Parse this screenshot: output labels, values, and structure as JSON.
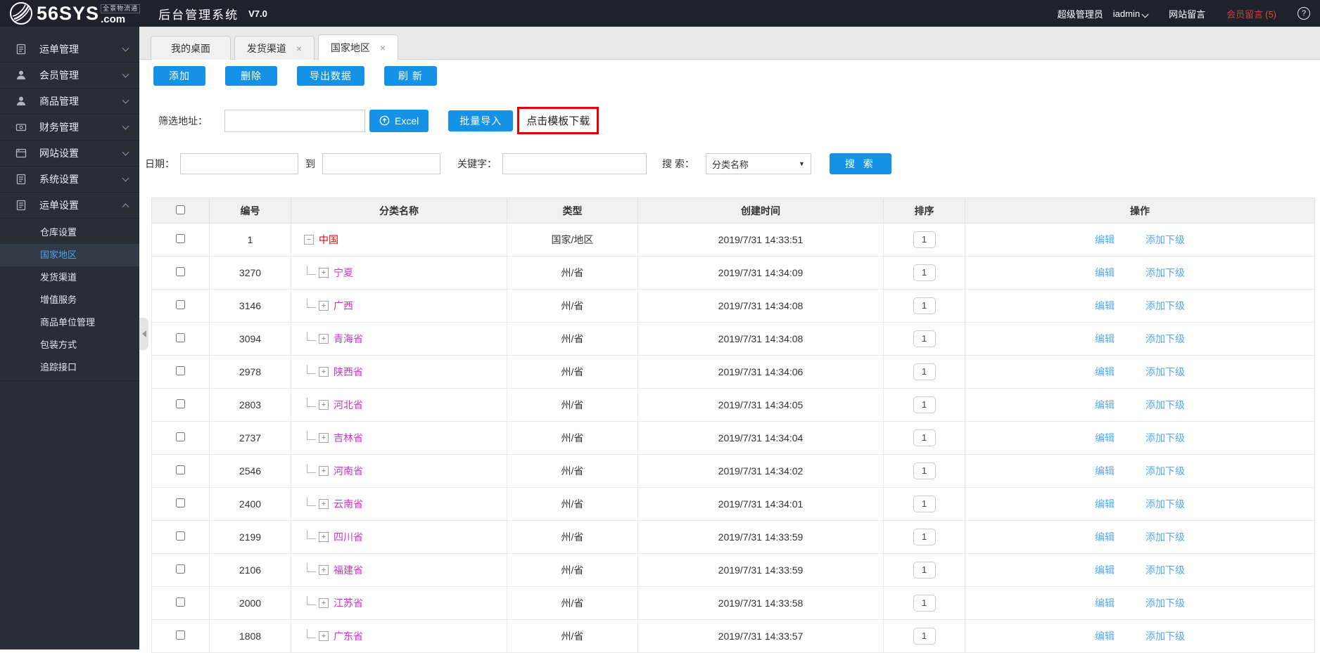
{
  "topbar": {
    "logo_main": "56SYS",
    "logo_suffix": ".com",
    "logo_tagline": "全景物流通",
    "app_title": "后台管理系统",
    "version": "V7.0",
    "role": "超级管理员",
    "username": "iadmin",
    "site_messages": "网站留言",
    "member_messages": "会员留言",
    "member_messages_count": "(5)",
    "help": "?"
  },
  "sidebar": {
    "items": [
      {
        "key": "waybill-manage",
        "label": "运单管理",
        "icon": "document-icon"
      },
      {
        "key": "member-manage",
        "label": "会员管理",
        "icon": "person-icon"
      },
      {
        "key": "goods-manage",
        "label": "商品管理",
        "icon": "person-icon"
      },
      {
        "key": "finance-manage",
        "label": "财务管理",
        "icon": "money-icon"
      },
      {
        "key": "site-settings",
        "label": "网站设置",
        "icon": "browser-icon"
      },
      {
        "key": "system-settings",
        "label": "系统设置",
        "icon": "document-icon"
      },
      {
        "key": "waybill-settings",
        "label": "运单设置",
        "icon": "document-icon",
        "expanded": true,
        "children": [
          {
            "key": "warehouse-settings",
            "label": "仓库设置"
          },
          {
            "key": "country-region",
            "label": "国家地区",
            "active": true
          },
          {
            "key": "shipping-channel",
            "label": "发货渠道"
          },
          {
            "key": "value-added",
            "label": "增值服务"
          },
          {
            "key": "goods-unit",
            "label": "商品单位管理"
          },
          {
            "key": "packing-method",
            "label": "包装方式"
          },
          {
            "key": "tracking-api",
            "label": "追踪接口"
          }
        ]
      }
    ]
  },
  "tabs": [
    {
      "key": "my-desktop",
      "label": "我的桌面",
      "closable": false,
      "active": false
    },
    {
      "key": "shipping-channel",
      "label": "发货渠道",
      "closable": true,
      "active": false
    },
    {
      "key": "country-region",
      "label": "国家地区",
      "closable": true,
      "active": true
    }
  ],
  "toolbar": {
    "add": "添加",
    "delete": "删除",
    "export": "导出数据",
    "refresh": "刷 新"
  },
  "filters": {
    "address_label": "筛选地址：",
    "address_value": "",
    "excel_button": "Excel",
    "batch_import": "批量导入",
    "template_download": "点击模板下载",
    "date_label": "日期：",
    "date_from": "",
    "to_label": "到",
    "date_to": "",
    "keyword_label": "关键字：",
    "keyword_value": "",
    "search_label": "搜 索：",
    "search_type_selected": "分类名称",
    "search_button": "搜 索"
  },
  "table": {
    "headers": [
      "编号",
      "分类名称",
      "类型",
      "创建时间",
      "排序",
      "操作"
    ],
    "edit_label": "编辑",
    "add_child_label": "添加下级",
    "rows": [
      {
        "id": "1",
        "name": "中国",
        "level": 0,
        "toggle": "−",
        "type": "国家/地区",
        "created": "2019/7/31 14:33:51",
        "sort": "1"
      },
      {
        "id": "3270",
        "name": "宁夏",
        "level": 1,
        "toggle": "+",
        "type": "州/省",
        "created": "2019/7/31 14:34:09",
        "sort": "1"
      },
      {
        "id": "3146",
        "name": "广西",
        "level": 1,
        "toggle": "+",
        "type": "州/省",
        "created": "2019/7/31 14:34:08",
        "sort": "1"
      },
      {
        "id": "3094",
        "name": "青海省",
        "level": 1,
        "toggle": "+",
        "type": "州/省",
        "created": "2019/7/31 14:34:08",
        "sort": "1"
      },
      {
        "id": "2978",
        "name": "陕西省",
        "level": 1,
        "toggle": "+",
        "type": "州/省",
        "created": "2019/7/31 14:34:06",
        "sort": "1"
      },
      {
        "id": "2803",
        "name": "河北省",
        "level": 1,
        "toggle": "+",
        "type": "州/省",
        "created": "2019/7/31 14:34:05",
        "sort": "1"
      },
      {
        "id": "2737",
        "name": "吉林省",
        "level": 1,
        "toggle": "+",
        "type": "州/省",
        "created": "2019/7/31 14:34:04",
        "sort": "1"
      },
      {
        "id": "2546",
        "name": "河南省",
        "level": 1,
        "toggle": "+",
        "type": "州/省",
        "created": "2019/7/31 14:34:02",
        "sort": "1"
      },
      {
        "id": "2400",
        "name": "云南省",
        "level": 1,
        "toggle": "+",
        "type": "州/省",
        "created": "2019/7/31 14:34:01",
        "sort": "1"
      },
      {
        "id": "2199",
        "name": "四川省",
        "level": 1,
        "toggle": "+",
        "type": "州/省",
        "created": "2019/7/31 14:33:59",
        "sort": "1"
      },
      {
        "id": "2106",
        "name": "福建省",
        "level": 1,
        "toggle": "+",
        "type": "州/省",
        "created": "2019/7/31 14:33:59",
        "sort": "1"
      },
      {
        "id": "2000",
        "name": "江苏省",
        "level": 1,
        "toggle": "+",
        "type": "州/省",
        "created": "2019/7/31 14:33:58",
        "sort": "1"
      },
      {
        "id": "1808",
        "name": "广东省",
        "level": 1,
        "toggle": "+",
        "type": "州/省",
        "created": "2019/7/31 14:33:57",
        "sort": "1"
      }
    ]
  },
  "colors": {
    "topbar_bg": "#1d222b",
    "sidebar_bg": "#272e38",
    "accent_blue": "#1592e6",
    "link_blue": "#54a8f0",
    "active_menu_blue": "#4aa0f2",
    "root_red": "#e60000",
    "child_magenta": "#cc33cc",
    "annotation_red": "#e60000",
    "member_msg_red": "#e74c3c"
  }
}
